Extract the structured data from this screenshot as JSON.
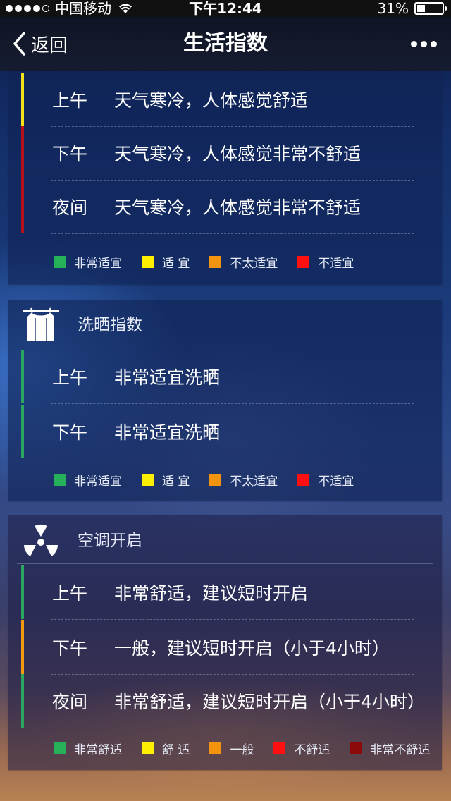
{
  "status": {
    "carrier": "中国移动",
    "time": "下午12:44",
    "battery": "31%",
    "battery_level": 0.31
  },
  "nav": {
    "back_label": "返回",
    "title": "生活指数"
  },
  "cards": [
    {
      "title": "",
      "rows": [
        {
          "period": "上午",
          "desc": "天气寒冷，人体感觉舒适",
          "color": "#f2e21a"
        },
        {
          "period": "下午",
          "desc": "天气寒冷，人体感觉非常不舒适",
          "color": "#b5121b"
        },
        {
          "period": "夜间",
          "desc": "天气寒冷，人体感觉非常不舒适",
          "color": "#b5121b"
        }
      ],
      "legend": [
        {
          "label": "非常适宜",
          "color": "#26b05a"
        },
        {
          "label": "适 宜",
          "color": "#ffef00"
        },
        {
          "label": "不太适宜",
          "color": "#f4930e"
        },
        {
          "label": "不适宜",
          "color": "#ff1010"
        }
      ]
    },
    {
      "title": "洗晒指数",
      "icon": "clothes-drying-icon",
      "rows": [
        {
          "period": "上午",
          "desc": "非常适宜洗晒",
          "color": "#2aa660"
        },
        {
          "period": "下午",
          "desc": "非常适宜洗晒",
          "color": "#2aa660"
        }
      ],
      "legend": [
        {
          "label": "非常适宜",
          "color": "#26b05a"
        },
        {
          "label": "适 宜",
          "color": "#ffef00"
        },
        {
          "label": "不太适宜",
          "color": "#f4930e"
        },
        {
          "label": "不适宜",
          "color": "#ff1010"
        }
      ]
    },
    {
      "title": "空调开启",
      "icon": "air-conditioner-fan-icon",
      "rows": [
        {
          "period": "上午",
          "desc": "非常舒适，建议短时开启",
          "color": "#2aa660"
        },
        {
          "period": "下午",
          "desc": "一般，建议短时开启（小于4小时）",
          "color": "#f49a10"
        },
        {
          "period": "夜间",
          "desc": "非常舒适，建议短时开启（小于4小时）",
          "color": "#2aa660"
        }
      ],
      "legend": [
        {
          "label": "非常舒适",
          "color": "#26b05a"
        },
        {
          "label": "舒 适",
          "color": "#ffef00"
        },
        {
          "label": "一般",
          "color": "#f4930e"
        },
        {
          "label": "不舒适",
          "color": "#ff1010"
        },
        {
          "label": "非常不舒适",
          "color": "#8b0a0a"
        }
      ]
    }
  ]
}
